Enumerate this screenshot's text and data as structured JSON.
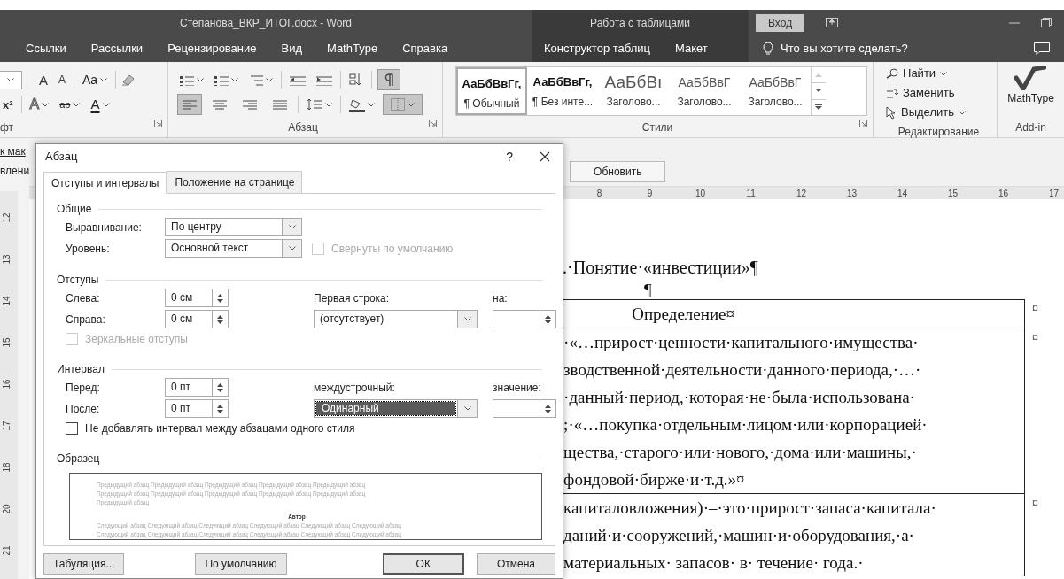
{
  "window": {
    "title": "Степанова_ВКР_ИТОГ.docx  -  Word",
    "context_title": "Работа с таблицами",
    "signin_button": "Вход"
  },
  "ribbon_tabs": [
    {
      "label": "Ссылки",
      "contextual": false
    },
    {
      "label": "Рассылки",
      "contextual": false
    },
    {
      "label": "Рецензирование",
      "contextual": false
    },
    {
      "label": "Вид",
      "contextual": false
    },
    {
      "label": "MathType",
      "contextual": false
    },
    {
      "label": "Справка",
      "contextual": false
    },
    {
      "label": "Конструктор таблиц",
      "contextual": true
    },
    {
      "label": "Макет",
      "contextual": true
    }
  ],
  "tell_me": "Что вы хотите сделать?",
  "ribbon": {
    "font": {
      "label": "фт",
      "row1": [
        "A",
        "A",
        "Aa"
      ],
      "row2": [
        "x²",
        "A",
        "ab",
        "A"
      ]
    },
    "paragraph": {
      "label": "Абзац",
      "show_marks": true,
      "align_buttons": [
        {
          "kind": "left",
          "selected": true
        },
        {
          "kind": "center",
          "selected": false
        },
        {
          "kind": "right",
          "selected": false
        },
        {
          "kind": "justify",
          "selected": false
        }
      ],
      "borders_active": true
    },
    "styles": {
      "label": "Стили",
      "items": [
        {
          "sample": "АаБбВвГг,",
          "name": "¶ Обычный",
          "kind": "bold",
          "selected": true
        },
        {
          "sample": "АаБбВвГг,",
          "name": "¶ Без инте...",
          "kind": "bold",
          "selected": false
        },
        {
          "sample": "АаБбВı",
          "name": "Заголово...",
          "kind": "large",
          "selected": false
        },
        {
          "sample": "АаБбВвГ",
          "name": "Заголово...",
          "kind": "medium",
          "selected": false
        },
        {
          "sample": "АаБбВвГ",
          "name": "Заголово...",
          "kind": "medium",
          "selected": false
        }
      ]
    },
    "editing": {
      "label": "Редактирование",
      "find": "Найти",
      "replace": "Заменить",
      "select": "Выделить"
    },
    "addin": {
      "label": "Add-in",
      "mathtype": "MathType"
    }
  },
  "left_pane": [
    "к мак",
    "влени"
  ],
  "document": {
    "update_button": "Обновить",
    "ruler_h": [
      "8",
      "9",
      "10",
      "11",
      "12",
      "13",
      "14",
      "15",
      "16",
      "17"
    ],
    "ruler_v": [
      "12",
      "13",
      "14",
      "15",
      "16",
      "17",
      "18",
      "20",
      "21"
    ],
    "heading": ".·Понятие·«инвестиции»¶",
    "empty_paragraph": "¶",
    "table_rows": [
      {
        "kind": "header",
        "lines": [
          "Определение¤"
        ],
        "end_mark": "¤"
      },
      {
        "kind": "body",
        "lines": [
          "·«…прирост·ценности·капитального·имущества·",
          "зводственной·деятельности·данного·периода,·…·",
          "·данный·период,·которая·не·была·использована·",
          ";·«…покупка·отдельным·лицом·или·корпорацией·",
          "щества,·старого·или·нового,·дома·или·машины,·",
          "фондовой·бирже·и·т.д.»¤"
        ],
        "end_mark": "¤"
      },
      {
        "kind": "body",
        "lines": [
          "капиталовложения)·–·это·прирост·запаса·капитала·",
          "даний·и·сооружений,·машин·и·оборудования,·а·",
          "материальных·  запасов·  в·  течение·  года.·"
        ],
        "end_mark": "¤"
      }
    ]
  },
  "dialog": {
    "title": "Абзац",
    "help": "?",
    "tabs": [
      {
        "label": "Отступы и интервалы",
        "selected": true
      },
      {
        "label": "Положение на странице",
        "selected": false
      }
    ],
    "general": {
      "heading": "Общие",
      "alignment": {
        "label": "Выравнивание:",
        "value": "По центру"
      },
      "level": {
        "label": "Уровень:",
        "value": "Основной текст"
      },
      "collapsed": {
        "label": "Свернуты по умолчанию",
        "checked": false,
        "disabled": true
      }
    },
    "indents": {
      "heading": "Отступы",
      "left": {
        "label": "Слева:",
        "value": "0 см"
      },
      "right": {
        "label": "Справа:",
        "value": "0 см"
      },
      "first_line": {
        "label": "Первая строка:",
        "value": "(отсутствует)"
      },
      "by": {
        "label": "на:"
      },
      "mirror": {
        "label": "Зеркальные отступы",
        "checked": false,
        "disabled": true
      }
    },
    "spacing": {
      "heading": "Интервал",
      "before": {
        "label": "Перед:",
        "value": "0 пт"
      },
      "after": {
        "label": "После:",
        "value": "0 пт"
      },
      "line": {
        "label": "междустрочный:",
        "value": "Одинарный",
        "focused": true
      },
      "at": {
        "label": "значение:"
      },
      "no_space": {
        "label": "Не добавлять интервал между абзацами одного стиля",
        "checked": false,
        "disabled": false
      }
    },
    "preview": {
      "heading": "Образец",
      "previous": [
        "Предыдущий абзац Предыдущий абзац Предыдущий абзац Предыдущий абзац Предыдущий абзац",
        "Предыдущий абзац Предыдущий абзац Предыдущий абзац Предыдущий абзац Предыдущий абзац",
        "Предыдущий абзац"
      ],
      "sample": "Автор",
      "next": [
        "Следующий абзац Следующий абзац Следующий абзац Следующий абзац Следующий абзац Следующий абзац",
        "Следующий абзац Следующий абзац Следующий абзац Следующий абзац Следующий абзац Следующий абзац"
      ]
    },
    "buttons": [
      {
        "label": "Табуляция...",
        "default": false
      },
      {
        "label": "По умолчанию",
        "default": false
      },
      {
        "label": "ОК",
        "default": true
      },
      {
        "label": "Отмена",
        "default": false
      }
    ]
  }
}
